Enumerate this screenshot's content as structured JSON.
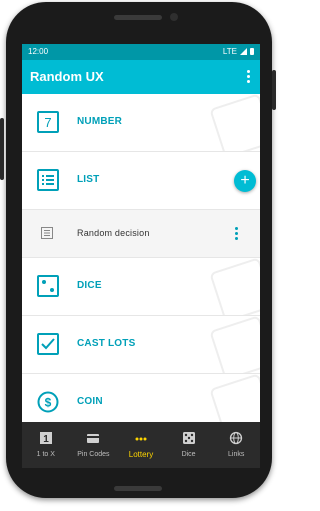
{
  "statusbar": {
    "time": "12:00",
    "network": "LTE"
  },
  "appbar": {
    "title": "Random UX"
  },
  "list": {
    "items": [
      {
        "label": "NUMBER",
        "icon": "seven-icon"
      },
      {
        "label": "LIST",
        "icon": "list-icon"
      },
      {
        "label": "Random decision",
        "icon": "document-icon"
      },
      {
        "label": "DICE",
        "icon": "dice-icon"
      },
      {
        "label": "CAST LOTS",
        "icon": "checkbox-icon"
      },
      {
        "label": "COIN",
        "icon": "dollar-coin-icon"
      }
    ],
    "number_glyph": "7",
    "fab_label": "+"
  },
  "bottomnav": {
    "items": [
      {
        "label": "1 to X",
        "icon": "one-icon",
        "active": false
      },
      {
        "label": "Pin Codes",
        "icon": "card-icon",
        "active": false
      },
      {
        "label": "Lottery",
        "icon": "lottery-dots-icon",
        "active": true
      },
      {
        "label": "Dice",
        "icon": "dice-icon",
        "active": false
      },
      {
        "label": "Links",
        "icon": "globe-icon",
        "active": false
      }
    ],
    "one_glyph": "1"
  },
  "colors": {
    "primary": "#00bcd4",
    "primary_dark": "#0097a7",
    "accent_text": "#00a0b8",
    "nav_bg": "#2b2b2b",
    "nav_active": "#ffd600"
  }
}
